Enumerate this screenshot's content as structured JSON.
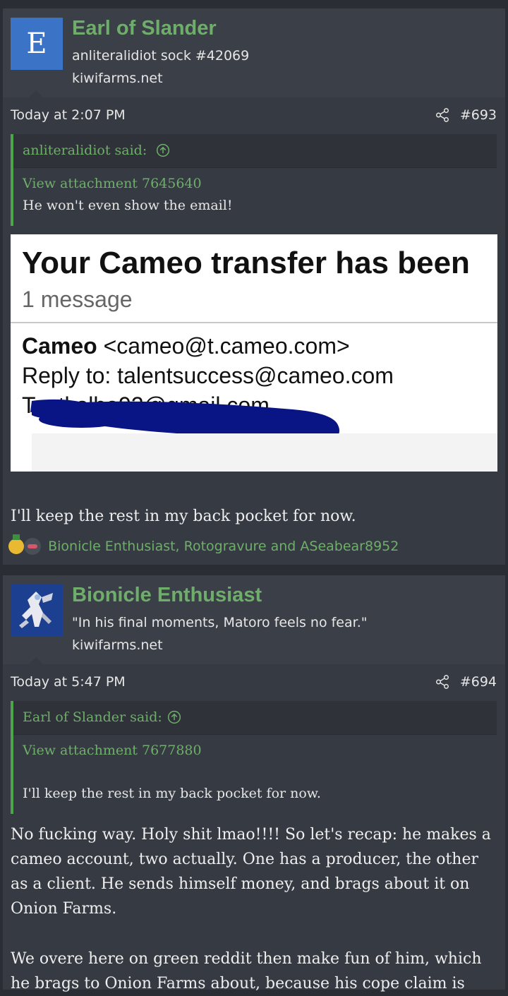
{
  "posts": [
    {
      "avatar_letter": "E",
      "username": "Earl of Slander",
      "user_title": "anliteralidiot sock #42069",
      "site": "kiwifarms.net",
      "date": "Today at 2:07 PM",
      "post_number": "#693",
      "quote": {
        "author": "anliteralidiot said:",
        "attachment": "View attachment 7645640",
        "text": "He won't even show the email!"
      },
      "image": {
        "subject": "Your Cameo transfer has been",
        "count": "1 message",
        "from_name": "Cameo",
        "from_addr": "<cameo@t.cameo.com>",
        "reply_to": "Reply to: talentsuccess@cameo.com",
        "to": "To: tkolbe92@gmail.com"
      },
      "body": "I'll keep the rest in my back pocket for now.",
      "reactions": "Bionicle Enthusiast, Rotogravure and ASeabear8952"
    },
    {
      "username": "Bionicle Enthusiast",
      "user_title": "\"In his final moments, Matoro feels no fear.\"",
      "site": "kiwifarms.net",
      "date": "Today at 5:47 PM",
      "post_number": "#694",
      "quote": {
        "author": "Earl of Slander said:",
        "attachment": "View attachment 7677880",
        "text": "I'll keep the rest in my back pocket for now."
      },
      "body_lines": [
        "No fucking way. Holy shit lmao!!!! So let's recap: he makes a",
        "cameo account, two actually. One has a producer, the other",
        "as a client. He sends himself money, and brags about it on",
        "Onion Farms.",
        "",
        "We overe here on green reddit then make fun of him, which",
        "he brags to Onion Farms about, because his cope claim is"
      ]
    }
  ],
  "colors": {
    "accent_green": "#6fae6a",
    "quote_border": "#4ea44a",
    "avatar_blue": "#3b73c7",
    "redaction": "#0a1585"
  },
  "icons": [
    "share-icon",
    "arrow-up-circle-icon",
    "medal-icon",
    "lips-icon"
  ]
}
